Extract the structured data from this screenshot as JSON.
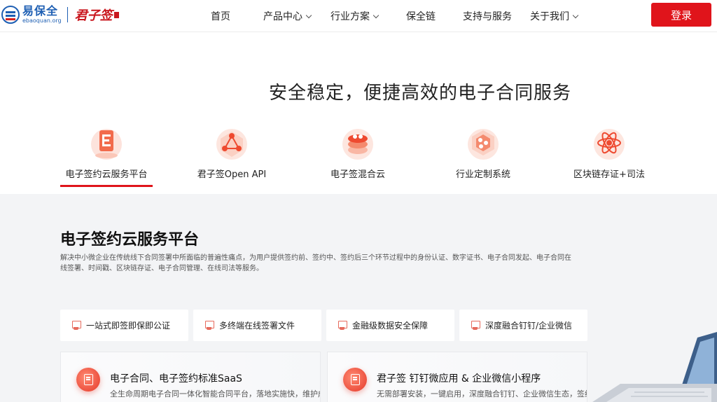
{
  "header": {
    "logo_cn": "易保全",
    "logo_en": "ebaoquan.org",
    "brand_jzq": "君子签",
    "nav": [
      {
        "label": "首页",
        "has_dropdown": false
      },
      {
        "label": "产品中心",
        "has_dropdown": true
      },
      {
        "label": "行业方案",
        "has_dropdown": true
      },
      {
        "label": "保全链",
        "has_dropdown": false
      },
      {
        "label": "支持与服务",
        "has_dropdown": false
      },
      {
        "label": "关于我们",
        "has_dropdown": true
      }
    ],
    "login_label": "登录"
  },
  "hero": {
    "title": "安全稳定，便捷高效的电子合同服务",
    "products": [
      {
        "label": "电子签约云服务平台",
        "icon": "document-e-icon",
        "active": true
      },
      {
        "label": "君子签Open API",
        "icon": "api-network-icon",
        "active": false
      },
      {
        "label": "电子签混合云",
        "icon": "hybrid-cloud-icon",
        "active": false
      },
      {
        "label": "行业定制系统",
        "icon": "custom-system-icon",
        "active": false
      },
      {
        "label": "区块链存证+司法",
        "icon": "blockchain-atom-icon",
        "active": false
      }
    ]
  },
  "section": {
    "title": "电子签约云服务平台",
    "description": "解决中小微企业在传统线下合同签署中所面临的普遍性痛点，为用户提供签约前、签约中、签约后三个环节过程中的身份认证、数字证书、电子合同发起、电子合同在线签署、时间戳、区块链存证、电子合同管理、在线司法等服务。",
    "features": [
      {
        "label": "一站式即签即保即公证",
        "icon": "monitor-icon"
      },
      {
        "label": "多终端在线签署文件",
        "icon": "monitor-icon"
      },
      {
        "label": "金融级数据安全保障",
        "icon": "monitor-icon"
      },
      {
        "label": "深度融合钉钉/企业微信",
        "icon": "monitor-icon"
      }
    ],
    "cards": [
      {
        "title": "电子合同、电子签约标准SaaS",
        "desc": "全生命周期电子合同一体化智能合同平台，落地实施快，维护成本",
        "icon": "contract-doc-icon"
      },
      {
        "title": "君子签 钉钉微应用 & 企业微信小程序",
        "desc": "无需部署安装，一键启用，深度融合钉钉、企业微信生态，签约、",
        "icon": "contract-doc-icon"
      }
    ]
  },
  "colors": {
    "accent": "#e0141b",
    "brand_blue": "#1e5fb3",
    "section_bg": "#f3f4f6"
  }
}
